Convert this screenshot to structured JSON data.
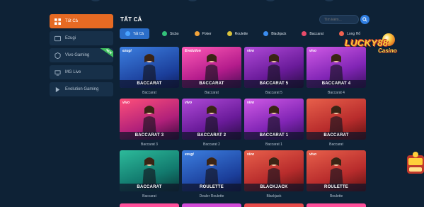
{
  "sidebar": {
    "items": [
      {
        "label": "Tất Cả",
        "icon": "grid-icon",
        "active": true
      },
      {
        "label": "Ezugi",
        "icon": "ezugi-icon",
        "active": false
      },
      {
        "label": "Vivo Gaming",
        "icon": "vivo-icon",
        "active": false,
        "badge": "NEW"
      },
      {
        "label": "MG Live",
        "icon": "mg-live-icon",
        "active": false
      },
      {
        "label": "Evolution Gaming",
        "icon": "evolution-icon",
        "active": false
      }
    ]
  },
  "main": {
    "title": "TẤT CẢ",
    "search_placeholder": "Tìm kiếm..."
  },
  "tabs": [
    {
      "label": "Tất Cả",
      "active": true,
      "color": "#4aa3ff"
    },
    {
      "label": "Sicbo",
      "active": false,
      "color": "#33c27a"
    },
    {
      "label": "Poker",
      "active": false,
      "color": "#f2a33a"
    },
    {
      "label": "Roulette",
      "active": false,
      "color": "#d9c23c"
    },
    {
      "label": "Blackjack",
      "active": false,
      "color": "#3b8df0"
    },
    {
      "label": "Baccarat",
      "active": false,
      "color": "#e94b6a"
    },
    {
      "label": "Long Hổ",
      "active": false,
      "color": "#f0624f"
    }
  ],
  "games": [
    {
      "banner": "BACCARAT",
      "name": "Baccarat",
      "provider": "ezugi",
      "bg": "bg-blue"
    },
    {
      "banner": "BACCARAT",
      "name": "Baccarat",
      "provider": "Evolution",
      "bg": "bg-pink"
    },
    {
      "banner": "BACCARAT 5",
      "name": "Baccarat 5",
      "provider": "vivo",
      "bg": "bg-purple"
    },
    {
      "banner": "BACCARAT 4",
      "name": "Baccarat 4",
      "provider": "vivo",
      "bg": "bg-violet"
    },
    {
      "banner": "BACCARAT 3",
      "name": "Baccarat 3",
      "provider": "vivo",
      "bg": "bg-redpurple"
    },
    {
      "banner": "BACCARAT 2",
      "name": "Baccarat 2",
      "provider": "vivo",
      "bg": "bg-purple"
    },
    {
      "banner": "BACCARAT 1",
      "name": "Baccarat 1",
      "provider": "vivo",
      "bg": "bg-violet"
    },
    {
      "banner": "BACCARAT",
      "name": "Baccarat",
      "provider": "",
      "bg": "bg-red"
    },
    {
      "banner": "BACCARAT",
      "name": "Baccarat",
      "provider": "",
      "bg": "bg-teal"
    },
    {
      "banner": "ROULETTE",
      "name": "Dealer Roulette",
      "provider": "ezugi",
      "bg": "bg-blue"
    },
    {
      "banner": "BLACKJACK",
      "name": "Blackjack",
      "provider": "vivo",
      "bg": "bg-red"
    },
    {
      "banner": "ROULETTE",
      "name": "Roulette",
      "provider": "vivo",
      "bg": "bg-red"
    }
  ],
  "bottom_row_colors": [
    "#ff4f9a",
    "#d24bd8",
    "#e84b4b",
    "#ff4f9a"
  ],
  "logo": {
    "brand": "LUCKY88",
    "sub": "Casino"
  },
  "colors": {
    "accent": "#e66a23",
    "tab_active": "#2b6ec9",
    "background": "#0e2236"
  }
}
